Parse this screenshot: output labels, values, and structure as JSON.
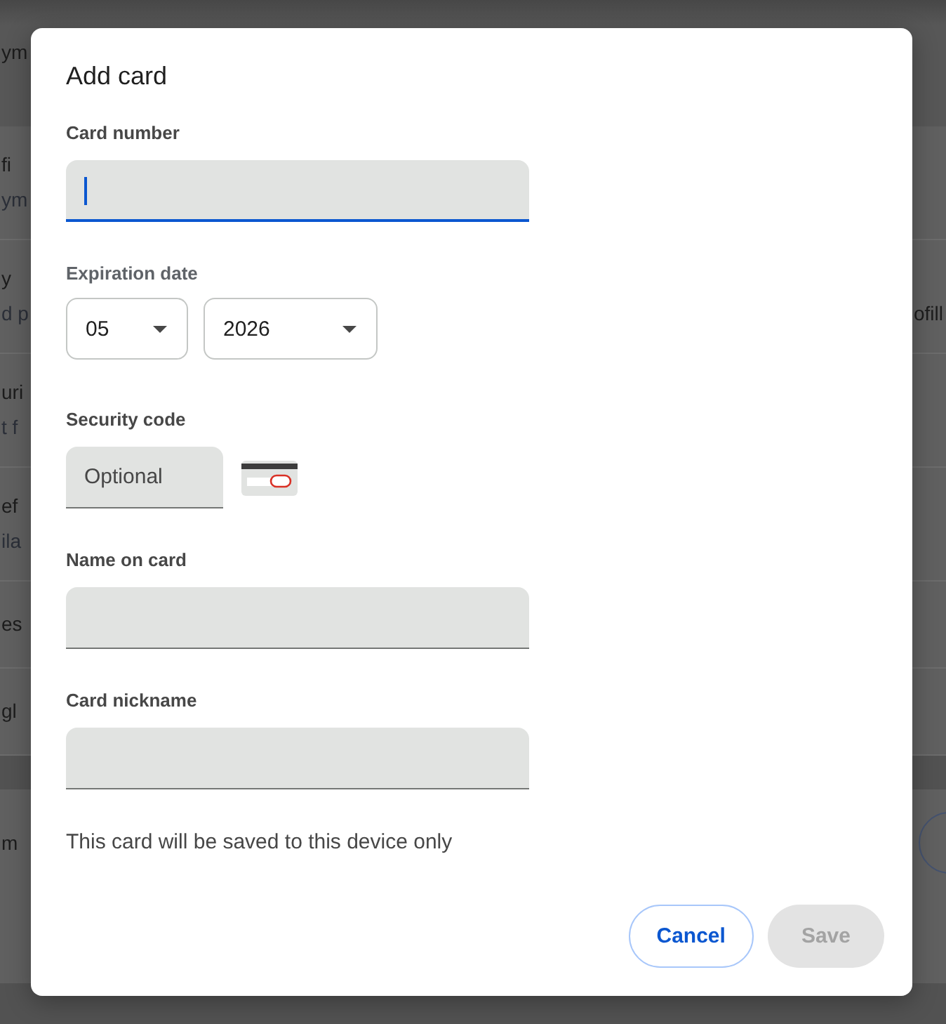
{
  "background_page": {
    "header_fragment": "ym",
    "settings_rows": [
      {
        "left_lines": [
          "fi",
          "ym"
        ]
      },
      {
        "left_lines": [
          "y",
          "d p"
        ],
        "right_fragment": "ofill"
      },
      {
        "left_lines": [
          "uri",
          "t f"
        ]
      },
      {
        "left_lines": [
          "ef",
          "ila"
        ]
      },
      {
        "left_lines": [
          "es"
        ]
      },
      {
        "left_lines": [
          "gl"
        ]
      }
    ],
    "lower_row": {
      "left_fragment": "m"
    }
  },
  "dialog": {
    "title": "Add card",
    "fields": [
      {
        "kind": "text",
        "label": "Card number",
        "focused": true
      },
      {
        "kind": "date",
        "label": "Expiration date",
        "focused": false,
        "selects": [
          {
            "value": "05"
          },
          {
            "value": "2026"
          }
        ]
      },
      {
        "kind": "cvc",
        "label": "Security code",
        "placeholder": "Optional",
        "focused": false
      },
      {
        "kind": "text",
        "label": "Name on card",
        "focused": false
      },
      {
        "kind": "text",
        "label": "Card nickname",
        "focused": false
      }
    ],
    "note": "This card will be saved to this device only",
    "buttons": [
      {
        "label": "Cancel",
        "kind": "outlined",
        "disabled": false
      },
      {
        "label": "Save",
        "kind": "filled",
        "disabled": true
      }
    ]
  }
}
